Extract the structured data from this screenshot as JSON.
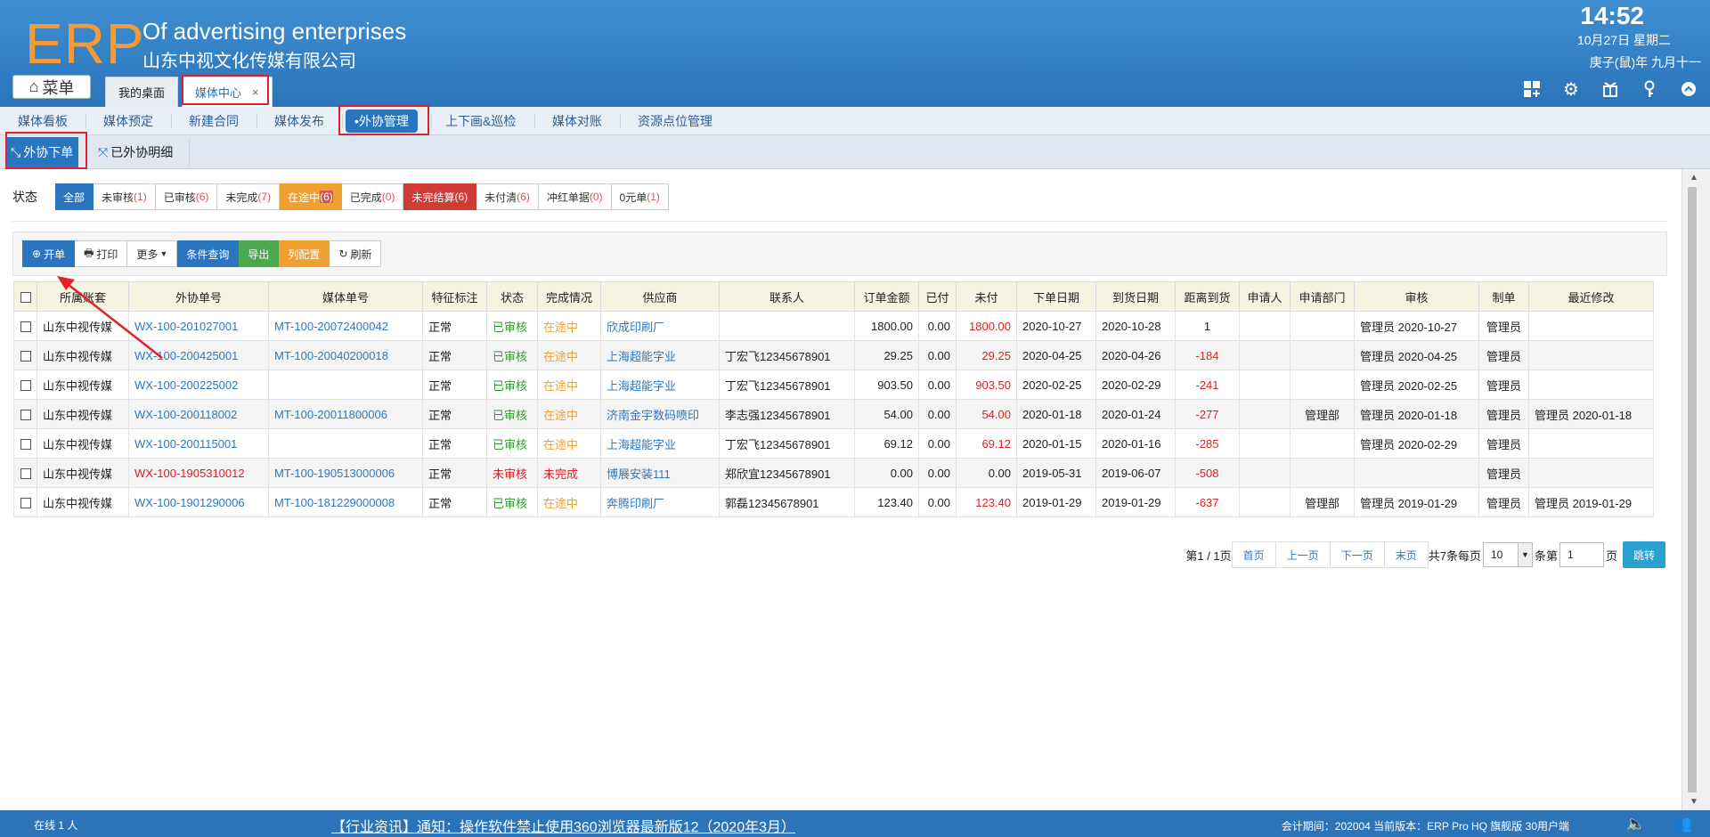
{
  "header": {
    "logo": "ERP",
    "company_en": "Of advertising enterprises",
    "company_cn": "山东中视文化传媒有限公司",
    "time": "14:52",
    "date": "10月27日 星期二",
    "lunar": "庚子(鼠)年 九月十一",
    "menu_label": "菜单",
    "tabs": [
      {
        "label": "我的桌面"
      },
      {
        "label": "媒体中心",
        "close": "×"
      }
    ],
    "icons": [
      "grid-add-icon",
      "gear-icon",
      "gift-icon",
      "key-icon",
      "collapse-up-icon"
    ]
  },
  "modnav": {
    "items": [
      {
        "label": "媒体看板"
      },
      {
        "label": "媒体预定"
      },
      {
        "label": "新建合同"
      },
      {
        "label": "媒体发布"
      },
      {
        "label": "•外协管理"
      },
      {
        "label": "上下画&巡检"
      },
      {
        "label": "媒体对账"
      },
      {
        "label": "资源点位管理"
      }
    ]
  },
  "subtabs": [
    {
      "label": "外协下单"
    },
    {
      "label": "已外协明细"
    }
  ],
  "status": {
    "label": "状态",
    "buttons": [
      {
        "text": "全部",
        "count": ""
      },
      {
        "text": "未审核",
        "count": "(1)"
      },
      {
        "text": "已审核",
        "count": "(6)"
      },
      {
        "text": "未完成",
        "count": "(7)"
      },
      {
        "text": "在途中",
        "count": "(6)"
      },
      {
        "text": "已完成",
        "count": "(0)"
      },
      {
        "text": "未完结算",
        "count": "(6)"
      },
      {
        "text": "未付清",
        "count": "(6)"
      },
      {
        "text": "冲红单据",
        "count": "(0)"
      },
      {
        "text": "0元单",
        "count": "(1)"
      }
    ]
  },
  "toolbar": {
    "new": "开单",
    "print": "打印",
    "more": "更多",
    "query": "条件查询",
    "export": "导出",
    "columns": "列配置",
    "refresh": "刷新"
  },
  "table": {
    "columns": [
      "所属账套",
      "外协单号",
      "媒体单号",
      "特征标注",
      "状态",
      "完成情况",
      "供应商",
      "联系人",
      "订单金额",
      "已付",
      "未付",
      "下单日期",
      "到货日期",
      "距离到货",
      "申请人",
      "申请部门",
      "审核",
      "制单",
      "最近修改"
    ],
    "rows": [
      [
        "山东中视传媒",
        "WX-100-201027001",
        "MT-100-20072400042",
        "正常",
        "已审核",
        "在途中",
        "欣成印刷厂",
        "",
        "1800.00",
        "0.00",
        "1800.00",
        "2020-10-27",
        "2020-10-28",
        "1",
        "",
        "",
        "管理员 2020-10-27",
        "管理员",
        ""
      ],
      [
        "山东中视传媒",
        "WX-100-200425001",
        "MT-100-20040200018",
        "正常",
        "已审核",
        "在途中",
        "上海超能字业",
        "丁宏飞12345678901",
        "29.25",
        "0.00",
        "29.25",
        "2020-04-25",
        "2020-04-26",
        "-184",
        "",
        "",
        "管理员 2020-04-25",
        "管理员",
        ""
      ],
      [
        "山东中视传媒",
        "WX-100-200225002",
        "",
        "正常",
        "已审核",
        "在途中",
        "上海超能字业",
        "丁宏飞12345678901",
        "903.50",
        "0.00",
        "903.50",
        "2020-02-25",
        "2020-02-29",
        "-241",
        "",
        "",
        "管理员 2020-02-25",
        "管理员",
        ""
      ],
      [
        "山东中视传媒",
        "WX-100-200118002",
        "MT-100-20011800006",
        "正常",
        "已审核",
        "在途中",
        "济南金宇数码喷印",
        "李志强12345678901",
        "54.00",
        "0.00",
        "54.00",
        "2020-01-18",
        "2020-01-24",
        "-277",
        "",
        "管理部",
        "管理员 2020-01-18",
        "管理员",
        "管理员 2020-01-18"
      ],
      [
        "山东中视传媒",
        "WX-100-200115001",
        "",
        "正常",
        "已审核",
        "在途中",
        "上海超能字业",
        "丁宏飞12345678901",
        "69.12",
        "0.00",
        "69.12",
        "2020-01-15",
        "2020-01-16",
        "-285",
        "",
        "",
        "管理员 2020-02-29",
        "管理员",
        ""
      ],
      [
        "山东中视传媒",
        "WX-100-1905310012",
        "MT-100-190513000006",
        "正常",
        "未审核",
        "未完成",
        "博展安装111",
        "郑欣宜12345678901",
        "0.00",
        "0.00",
        "0.00",
        "2019-05-31",
        "2019-06-07",
        "-508",
        "",
        "",
        "",
        "管理员",
        ""
      ],
      [
        "山东中视传媒",
        "WX-100-1901290006",
        "MT-100-181229000008",
        "正常",
        "已审核",
        "在途中",
        "奔腾印刷厂",
        "郭磊12345678901",
        "123.40",
        "0.00",
        "123.40",
        "2019-01-29",
        "2019-01-29",
        "-637",
        "",
        "管理部",
        "管理员 2019-01-29",
        "管理员",
        "管理员 2019-01-29"
      ]
    ]
  },
  "pager": {
    "page_info": "第1 / 1页",
    "first": "首页",
    "prev": "上一页",
    "next": "下一页",
    "last": "末页",
    "total_prefix": "共7条每页",
    "page_size": "10",
    "goto_prefix": "条第",
    "goto_value": "1",
    "goto_suffix": "页",
    "go": "跳转"
  },
  "footer": {
    "online": "在线   1   人",
    "news": "【行业资讯】通知：操作软件禁止使用360浏览器最新版12（2020年3月）",
    "info": "会计期间：202004  当前版本：ERP Pro HQ 旗舰版 30用户端"
  },
  "colors": {
    "header_blue": "#2b74ba",
    "accent_blue": "#2a75c0",
    "orange": "#f0a030",
    "red": "#e02020",
    "green": "#2d9f2d",
    "annotation_red": "#e0202c"
  }
}
